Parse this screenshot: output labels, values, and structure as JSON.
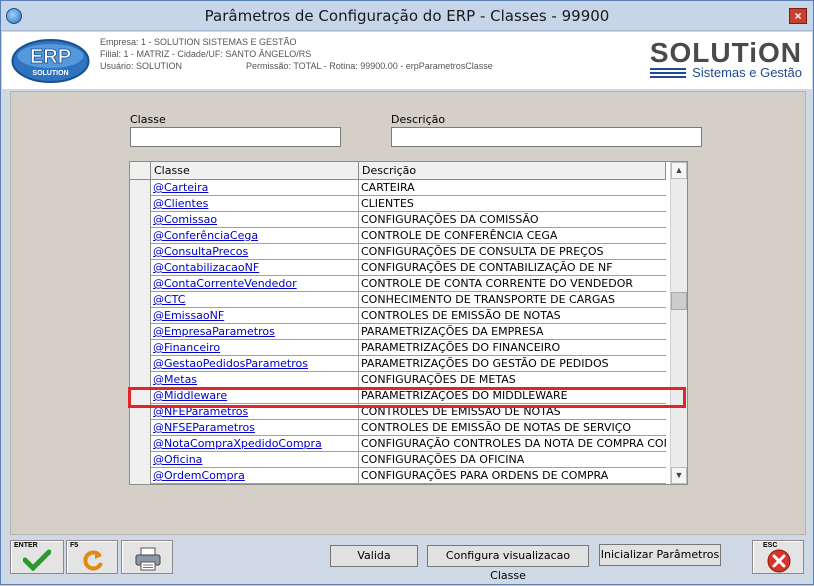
{
  "window": {
    "title": "Parâmetros de Configuração do ERP - Classes - 99900",
    "close_label": "×"
  },
  "header": {
    "logo_top": "ERP",
    "logo_bottom": "SOLUTION",
    "empresa": "Empresa: 1 - SOLUTION SISTEMAS E GESTÃO",
    "filial": "Filial: 1 - MATRIZ - Cidade/UF: SANTO ÂNGELO/RS",
    "usuario": "Usuário: SOLUTION",
    "permissao": "Permissão: TOTAL - Rotina: 99900.00 - erpParametrosClasse",
    "brand_main": "SOLUTiON",
    "brand_sub": "Sistemas e Gestão"
  },
  "filters": {
    "classe_label": "Classe",
    "classe_value": "",
    "descricao_label": "Descrição",
    "descricao_value": ""
  },
  "grid": {
    "col_classe": "Classe",
    "col_descricao": "Descrição",
    "rows": [
      {
        "classe": "@Carteira",
        "descricao": "CARTEIRA"
      },
      {
        "classe": "@Clientes",
        "descricao": "CLIENTES"
      },
      {
        "classe": "@Comissao",
        "descricao": "CONFIGURAÇÕES DA COMISSÃO"
      },
      {
        "classe": "@ConferênciaCega",
        "descricao": "CONTROLE DE CONFERÊNCIA CEGA"
      },
      {
        "classe": "@ConsultaPrecos",
        "descricao": "CONFIGURAÇÕES DE CONSULTA DE PREÇOS"
      },
      {
        "classe": "@ContabilizacaoNF",
        "descricao": "CONFIGURAÇÕES DE CONTABILIZAÇÃO DE NF"
      },
      {
        "classe": "@ContaCorrenteVendedor",
        "descricao": "CONTROLE DE CONTA CORRENTE DO VENDEDOR"
      },
      {
        "classe": "@CTC",
        "descricao": "CONHECIMENTO DE TRANSPORTE DE CARGAS"
      },
      {
        "classe": "@EmissaoNF",
        "descricao": "CONTROLES DE EMISSÃO DE NOTAS"
      },
      {
        "classe": "@EmpresaParametros",
        "descricao": "PARAMETRIZAÇÕES DA EMPRESA"
      },
      {
        "classe": "@Financeiro",
        "descricao": "PARAMETRIZAÇÕES DO FINANCEIRO"
      },
      {
        "classe": "@GestaoPedidosParametros",
        "descricao": "PARAMETRIZAÇÕES DO GESTÃO DE PEDIDOS"
      },
      {
        "classe": "@Metas",
        "descricao": "CONFIGURAÇÕES DE METAS"
      },
      {
        "classe": "@Middleware",
        "descricao": "PARAMETRIZAÇÕES DO MIDDLEWARE"
      },
      {
        "classe": "@NFEParametros",
        "descricao": "CONTROLES DE EMISSÃO DE NOTAS"
      },
      {
        "classe": "@NFSEParametros",
        "descricao": "CONTROLES DE EMISSÃO DE NOTAS DE SERVIÇO"
      },
      {
        "classe": "@NotaCompraXpedidoCompra",
        "descricao": "CONFIGURAÇÃO CONTROLES DA NOTA DE COMPRA COM PEDIDO"
      },
      {
        "classe": "@Oficina",
        "descricao": "CONFIGURAÇÕES DA OFICINA"
      },
      {
        "classe": "@OrdemCompra",
        "descricao": "CONFIGURAÇÕES PARA ORDENS DE COMPRA"
      }
    ],
    "scroll_up": "▲",
    "scroll_down": "▼"
  },
  "footer": {
    "enter_key": "ENTER",
    "f5_key": "F5",
    "esc_key": "ESC",
    "valida": "Valida",
    "configura": "Configura visualizacao Classe",
    "inicializar": "Inicializar Parâmetros"
  },
  "colors": {
    "highlight": "#e0262a",
    "link": "#0000cc",
    "brand": "#1e4b8f"
  },
  "icons": [
    "app-icon",
    "close-icon",
    "check-icon",
    "refresh-icon",
    "printer-icon",
    "cancel-icon"
  ]
}
